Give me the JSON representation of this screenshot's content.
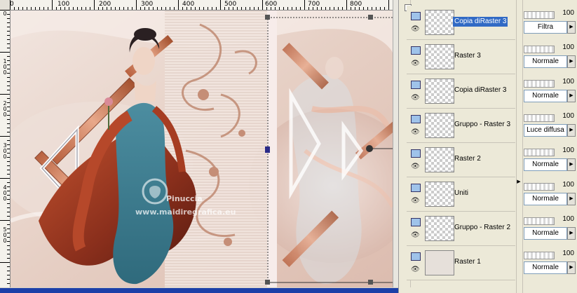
{
  "ruler": {
    "top_ticks": [
      "0",
      "100",
      "200",
      "300",
      "400",
      "500",
      "600",
      "700",
      "800"
    ],
    "left_ticks": [
      "0",
      "1\n0\n0",
      "2\n0\n0",
      "3\n0\n0",
      "4\n0\n0",
      "5\n0\n0"
    ]
  },
  "watermark": {
    "name": "Pinuccia",
    "url": "www.maidiregrafica.eu"
  },
  "layers": [
    {
      "name": "Copia diRaster 3",
      "opacity": "100",
      "blend": "Filtra",
      "selected": true
    },
    {
      "name": "Raster 3",
      "opacity": "100",
      "blend": "Normale",
      "selected": false
    },
    {
      "name": "Copia diRaster 3",
      "opacity": "100",
      "blend": "Normale",
      "selected": false
    },
    {
      "name": "Gruppo - Raster 3",
      "opacity": "100",
      "blend": "Luce diffusa",
      "selected": false
    },
    {
      "name": "Raster 2",
      "opacity": "100",
      "blend": "Normale",
      "selected": false
    },
    {
      "name": "Uniti",
      "opacity": "100",
      "blend": "Normale",
      "selected": false
    },
    {
      "name": "Gruppo - Raster 2",
      "opacity": "100",
      "blend": "Normale",
      "selected": false
    },
    {
      "name": "Raster 1",
      "opacity": "100",
      "blend": "Normale",
      "selected": false
    }
  ],
  "colors": {
    "selection": "#316ac5",
    "panel_bg": "#ece9d8",
    "scroll_blue": "#1c3fa8"
  }
}
